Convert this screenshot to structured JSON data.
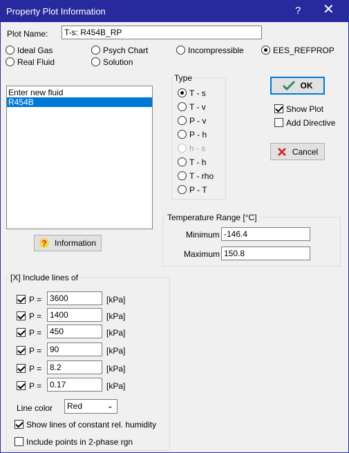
{
  "window": {
    "title": "Property Plot Information",
    "help_glyph": "?",
    "close_glyph": "✕"
  },
  "plot_name": {
    "label": "Plot Name:",
    "value": "T-s: R454B_RP"
  },
  "fluid_types": [
    {
      "label": "Ideal Gas",
      "selected": false
    },
    {
      "label": "Psych Chart",
      "selected": false
    },
    {
      "label": "Incompressible",
      "selected": false
    },
    {
      "label": "EES_REFPROP",
      "selected": true
    },
    {
      "label": "Real Fluid",
      "selected": false
    },
    {
      "label": "Solution",
      "selected": false
    }
  ],
  "fluid_list": {
    "items": [
      "Enter new fluid",
      "R454B"
    ],
    "selected_index": 1
  },
  "info_button": {
    "label": "Information",
    "icon": "question-mark-icon"
  },
  "type_group": {
    "title": "Type",
    "options": [
      {
        "label": "T - s",
        "selected": true,
        "enabled": true
      },
      {
        "label": "T - v",
        "selected": false,
        "enabled": true
      },
      {
        "label": "P - v",
        "selected": false,
        "enabled": true
      },
      {
        "label": "P - h",
        "selected": false,
        "enabled": true
      },
      {
        "label": "h - s",
        "selected": false,
        "enabled": false
      },
      {
        "label": "T - h",
        "selected": false,
        "enabled": true
      },
      {
        "label": "T - rho",
        "selected": false,
        "enabled": true
      },
      {
        "label": "P - T",
        "selected": false,
        "enabled": true
      }
    ]
  },
  "ok_button": {
    "label": "OK",
    "icon": "checkmark-icon",
    "icon_color": "#2e8b57"
  },
  "cancel_button": {
    "label": "Cancel",
    "icon": "cross-icon",
    "icon_color": "#d32f2f"
  },
  "show_plot": {
    "label": "Show Plot",
    "checked": true
  },
  "add_directive": {
    "label": "Add Directive",
    "checked": false
  },
  "temperature_range": {
    "title": "Temperature Range  [°C]",
    "minimum_label": "Minimum",
    "minimum_value": "-146.4",
    "maximum_label": "Maximum",
    "maximum_value": "150.8"
  },
  "include_lines": {
    "title": "[X] Include lines of",
    "lines": [
      {
        "prefix": "P =",
        "value": "3600",
        "unit": "[kPa]",
        "checked": true
      },
      {
        "prefix": "P =",
        "value": "1400",
        "unit": "[kPa]",
        "checked": true
      },
      {
        "prefix": "P =",
        "value": "450",
        "unit": "[kPa]",
        "checked": true
      },
      {
        "prefix": "P =",
        "value": "90",
        "unit": "[kPa]",
        "checked": true
      },
      {
        "prefix": "P =",
        "value": "8.2",
        "unit": "[kPa]",
        "checked": true
      },
      {
        "prefix": "P =",
        "value": "0.17",
        "unit": "[kPa]",
        "checked": true
      }
    ],
    "line_color_label": "Line color",
    "line_color_value": "Red",
    "humidity": {
      "label": "Show lines of constant rel. humidity",
      "checked": true
    },
    "two_phase": {
      "label": "Include points in 2-phase rgn",
      "checked": false
    }
  }
}
